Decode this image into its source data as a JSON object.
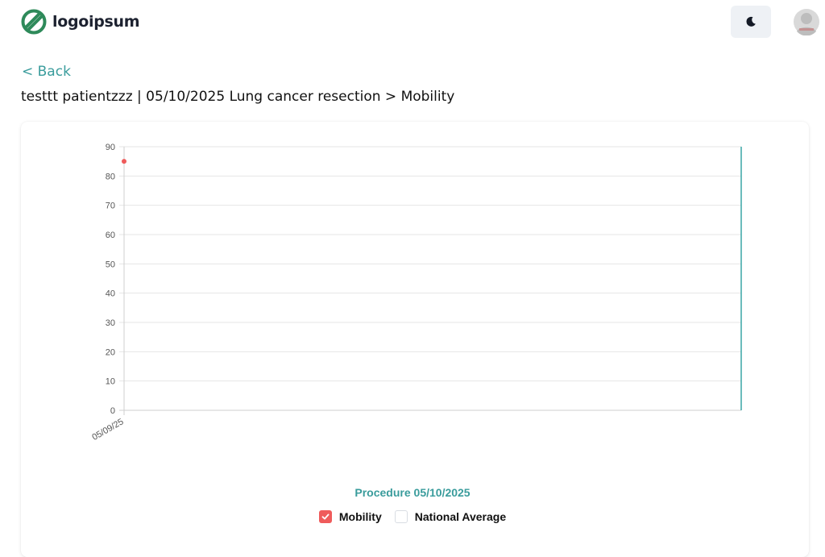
{
  "header": {
    "logo_text": "logoipsum",
    "logo_color": "#2e8a5a",
    "theme_toggle_icon": "moon-icon",
    "avatar_icon": "user-avatar-icon"
  },
  "navigation": {
    "back_label": "< Back",
    "breadcrumb": "testtt patientzzz | 05/10/2025 Lung cancer resection > Mobility"
  },
  "chart_data": {
    "type": "scatter",
    "ylim": [
      0,
      90
    ],
    "yticks": [
      0,
      10,
      20,
      30,
      40,
      50,
      60,
      70,
      80,
      90
    ],
    "x_tick_labels": [
      "05/09/25"
    ],
    "grid": true,
    "series": [
      {
        "name": "Mobility",
        "color": "#ef5b5b",
        "checked": true,
        "points": [
          {
            "x": "05/09/25",
            "y": 85
          }
        ]
      },
      {
        "name": "National Average",
        "checked": false,
        "points": []
      }
    ],
    "procedure_marker": {
      "label": "Procedure 05/10/2025",
      "color": "#3aa6a6"
    }
  },
  "legend": {
    "items": [
      "Mobility",
      "National Average"
    ]
  }
}
